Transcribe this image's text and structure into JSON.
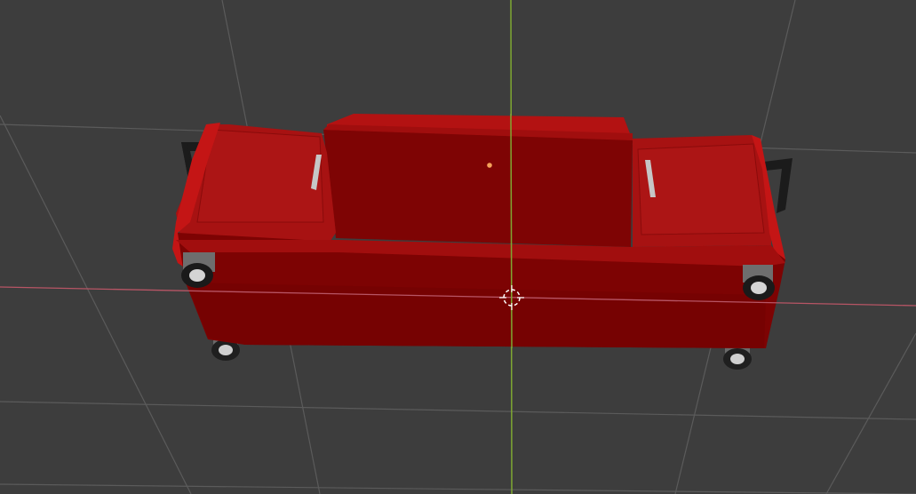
{
  "viewport": {
    "background_color": "#3d3d3d",
    "grid_color": "#5b5b5b",
    "x_axis_color": "#b75565",
    "y_axis_color": "#7fa832",
    "model_color": "#b81313",
    "model_shadow_color": "#7a0404",
    "object_origin_color": "#f5a35a"
  },
  "icons": {
    "cursor": "3d-cursor-icon",
    "origin": "object-origin-icon"
  }
}
